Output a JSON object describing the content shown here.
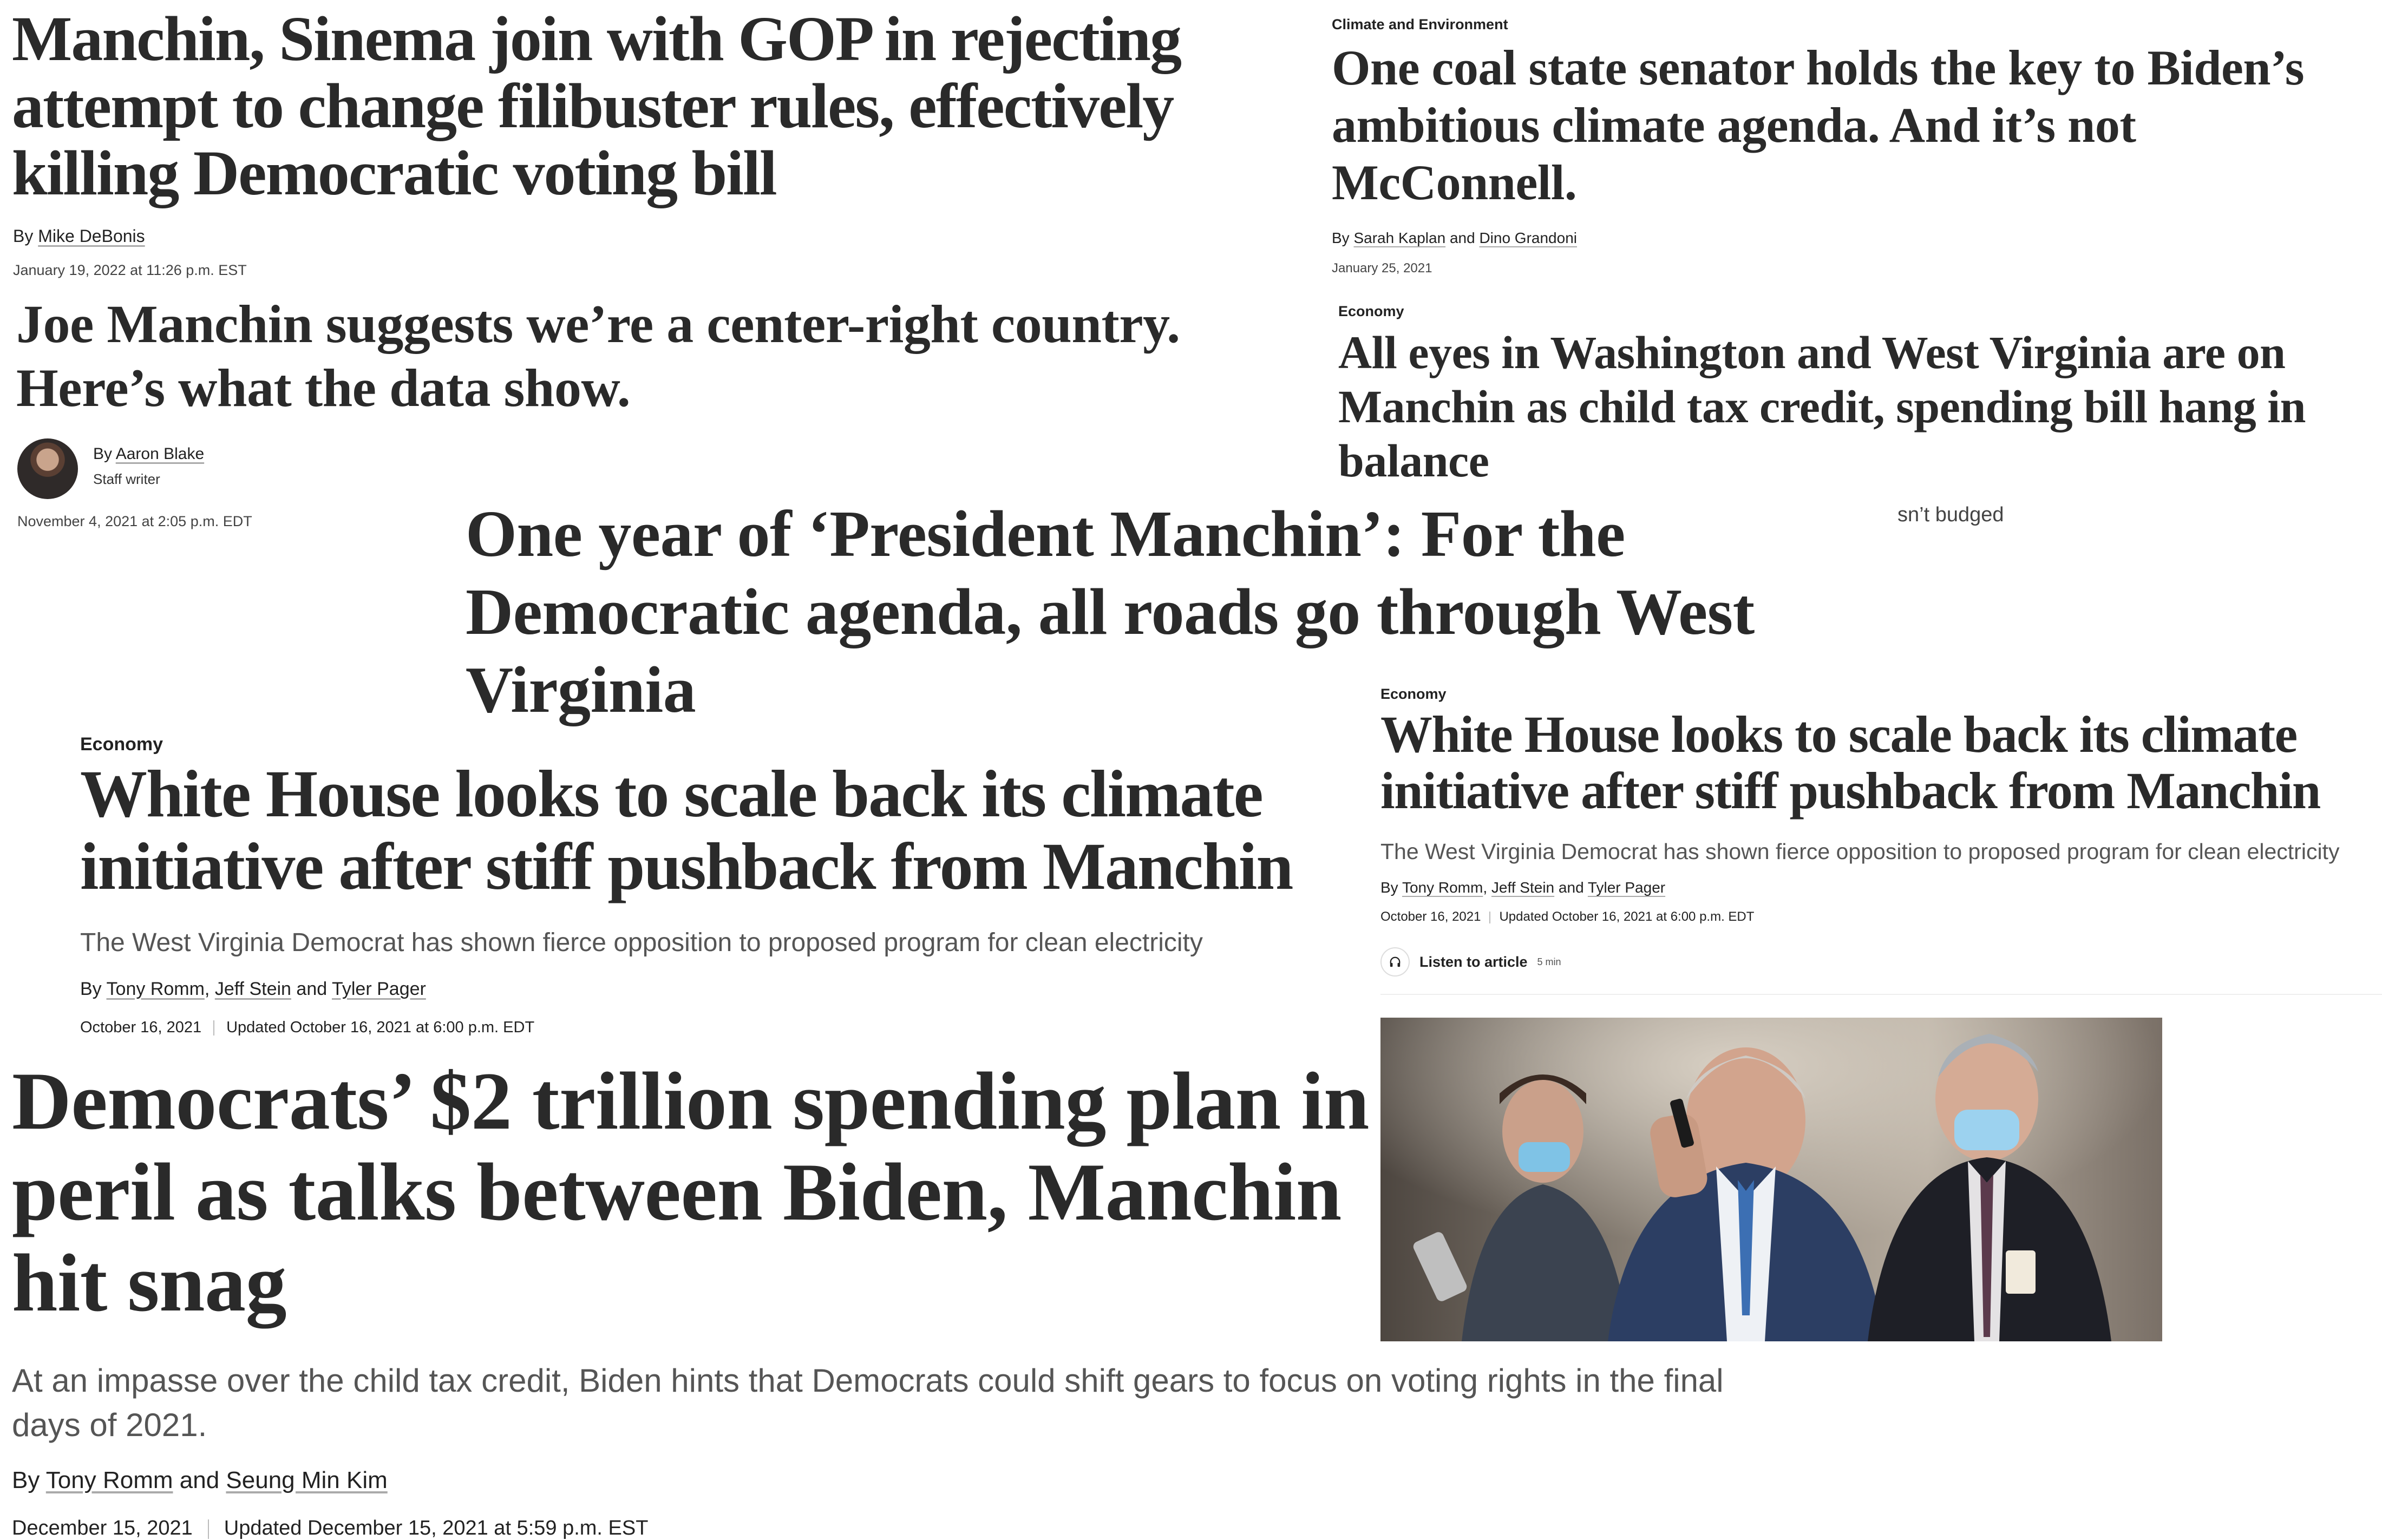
{
  "clips": {
    "filibuster": {
      "headline": "Manchin, Sinema join with GOP in rejecting attempt to change filibuster rules, effectively killing Democratic voting bill",
      "by": "By",
      "author": "Mike DeBonis",
      "date": "January 19, 2022 at 11:26 p.m. EST"
    },
    "coal_state": {
      "section": "Climate and Environment",
      "headline": "One coal state senator holds the key to Biden’s ambitious climate agenda. And it’s not McConnell.",
      "by": "By",
      "author1": "Sarah Kaplan",
      "and": "and",
      "author2": "Dino Grandoni",
      "date": "January 25, 2021"
    },
    "center_right": {
      "headline": "Joe Manchin suggests we’re a center-right country. Here’s what the data show.",
      "by": "By",
      "author": "Aaron Blake",
      "role": "Staff writer",
      "date": "November 4, 2021 at 2:05 p.m. EDT"
    },
    "all_eyes": {
      "section": "Economy",
      "headline": "All eyes in Washington and West Virginia are on Manchin as child tax credit, spending bill hang in balance",
      "fragment": "sn’t budged"
    },
    "president_manchin": {
      "headline": "One year of ‘President Manchin’: For the Democratic agenda, all roads go through West Virginia"
    },
    "white_house_large": {
      "section": "Economy",
      "headline": "White House looks to scale back its climate initiative after stiff pushback from Manchin",
      "dek": "The West Virginia Democrat has shown fierce opposition to proposed program for clean electricity",
      "by": "By",
      "author1": "Tony Romm",
      "comma": ",",
      "author2": "Jeff Stein",
      "and": "and",
      "author3": "Tyler Pager",
      "date": "October 16, 2021",
      "updated": "Updated October 16, 2021 at 6:00 p.m. EDT"
    },
    "white_house_small": {
      "section": "Economy",
      "headline": "White House looks to scale back its climate initiative after stiff pushback from Manchin",
      "dek": "The West Virginia Democrat has shown fierce opposition to proposed program for clean electricity",
      "by": "By",
      "author1": "Tony Romm",
      "comma": ",",
      "author2": "Jeff Stein",
      "and": "and",
      "author3": "Tyler Pager",
      "date": "October 16, 2021",
      "updated": "Updated October 16, 2021 at 6:00 p.m. EDT",
      "listen_label": "Listen to article",
      "listen_duration": "5 min",
      "listen_icon": "headphones-icon"
    },
    "spending_plan": {
      "headline_line1": "Democrats’ $2 trillion spending plan in",
      "headline_line2": "peril as talks between Biden, Manchin",
      "headline_line3": "hit snag",
      "dek": "At an impasse over the child tax credit, Biden hints that Democrats could shift gears to focus on voting rights in the final days of 2021.",
      "by": "By",
      "author1": "Tony Romm",
      "and": "and",
      "author2": "Seung Min Kim",
      "date": "December 15, 2021",
      "updated": "Updated December 15, 2021 at 5:59 p.m. EST"
    }
  },
  "colors": {
    "headline": "#2a2a2a",
    "dek": "#555555",
    "background": "#ffffff"
  }
}
